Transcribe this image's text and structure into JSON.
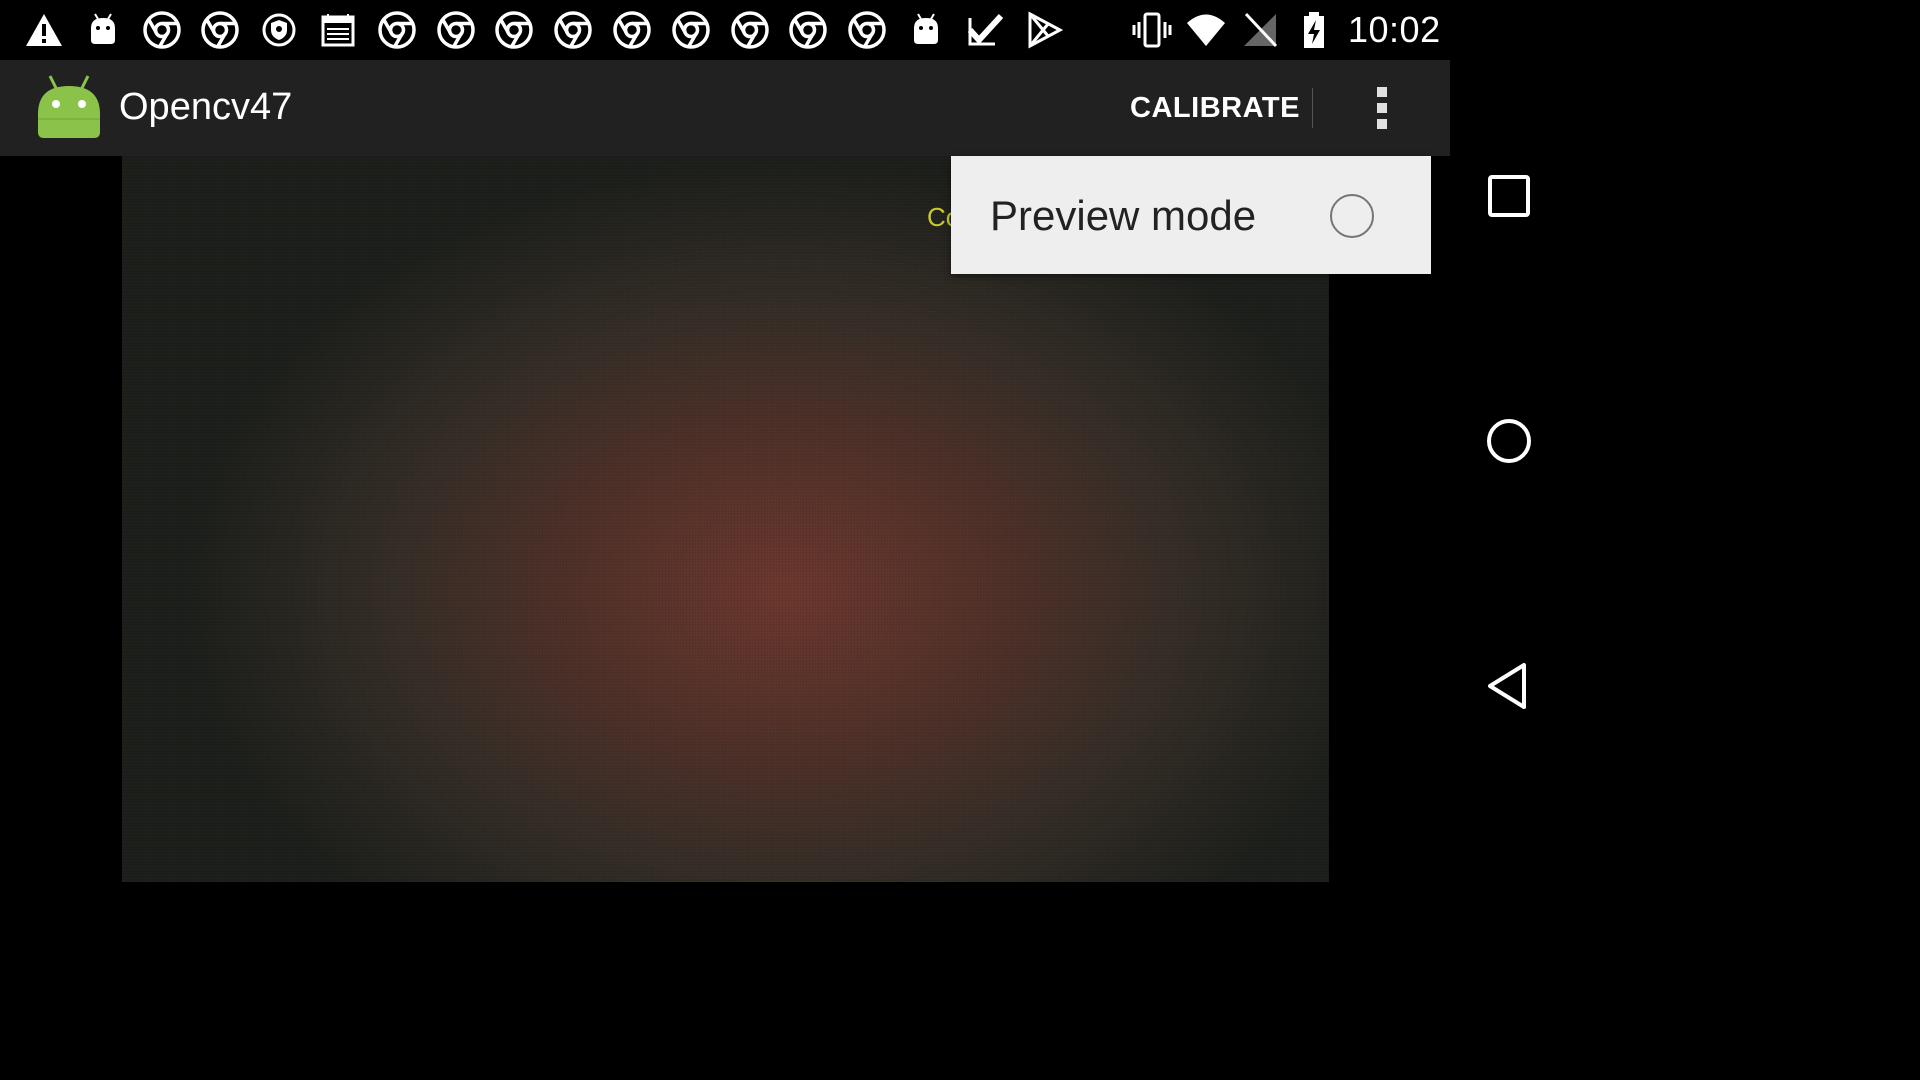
{
  "status_bar": {
    "time": "10:02",
    "left_icons": [
      "warning-icon",
      "android-icon",
      "chrome-icon",
      "chrome-icon",
      "shield-icon",
      "calendar-icon",
      "chrome-icon",
      "chrome-icon",
      "chrome-icon",
      "chrome-icon",
      "chrome-icon",
      "chrome-icon",
      "chrome-icon",
      "chrome-icon",
      "chrome-icon",
      "android-icon",
      "checkmark-icon",
      "play-store-icon"
    ],
    "right_icons": [
      "vibrate-icon",
      "wifi-icon",
      "no-sim-icon",
      "battery-charging-icon"
    ]
  },
  "action_bar": {
    "title": "Opencv47",
    "calibrate_label": "CALIBRATE",
    "background": "#212121"
  },
  "camera": {
    "overlay_text": "Co",
    "overlay_color": "#c9c92a"
  },
  "popup_menu": {
    "items": [
      {
        "label": "Preview mode",
        "checked": false
      }
    ]
  },
  "nav_bar": {
    "buttons": [
      "recents-icon",
      "home-icon",
      "back-icon"
    ]
  }
}
